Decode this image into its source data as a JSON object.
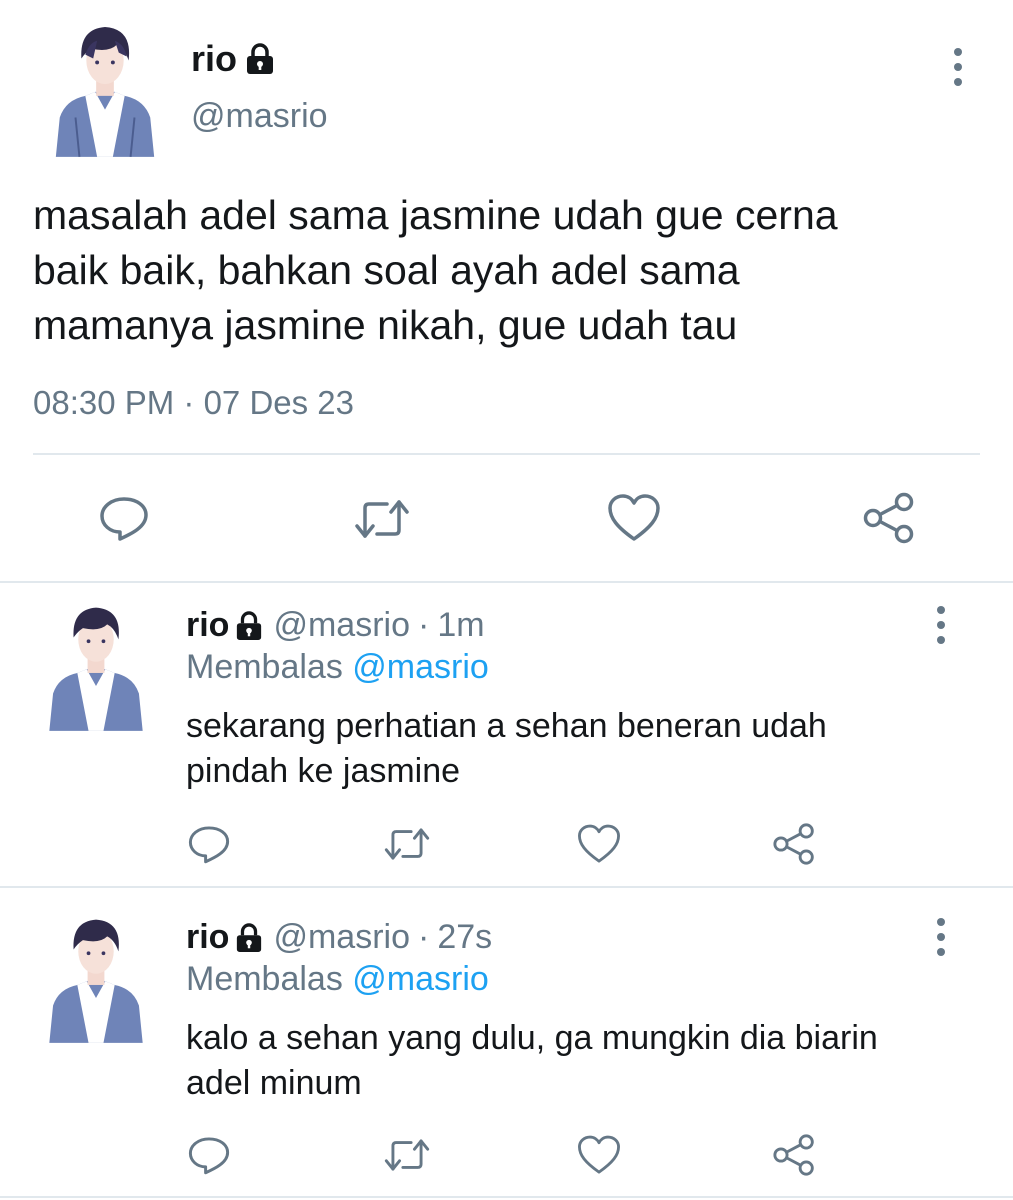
{
  "main_tweet": {
    "name": "rio",
    "handle": "@masrio",
    "lines": [
      "masalah adel sama jasmine udah gue cerna",
      "baik baik, bahkan soal ayah adel sama",
      "mamanya jasmine nikah, gue udah tau"
    ],
    "timestamp": "08:30 PM · 07 Des 23",
    "icons": {
      "more": "more-vertical-icon",
      "reply": "reply-icon",
      "retweet": "retweet-icon",
      "like": "heart-icon",
      "share": "share-icon",
      "lock": "lock-icon"
    }
  },
  "replies": [
    {
      "name": "rio",
      "handle": "@masrio",
      "separator": "·",
      "time": "1m",
      "replying_label": "Membalas",
      "replying_to": "@masrio",
      "lines": [
        "sekarang perhatian a sehan beneran udah",
        "pindah ke jasmine"
      ]
    },
    {
      "name": "rio",
      "handle": "@masrio",
      "separator": "·",
      "time": "27s",
      "replying_label": "Membalas",
      "replying_to": "@masrio",
      "lines": [
        "kalo a sehan yang dulu, ga mungkin dia biarin",
        "adel minum"
      ]
    }
  ],
  "colors": {
    "text": "#14171a",
    "secondary": "#657786",
    "mention": "#1da1f2",
    "divider": "#e1e8ed"
  }
}
